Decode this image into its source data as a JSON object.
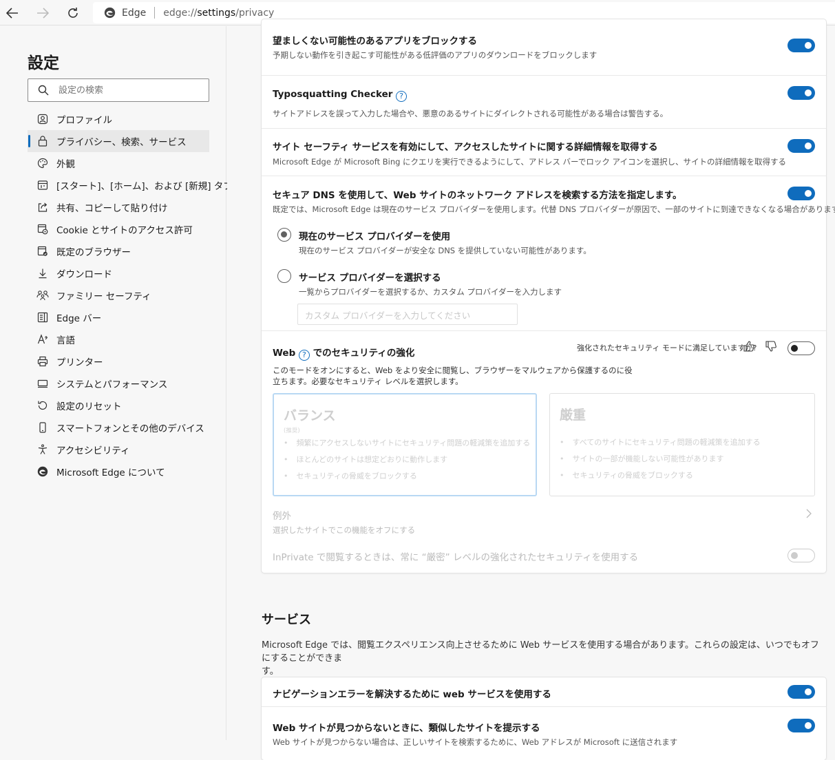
{
  "browser": {
    "site_label": "Edge",
    "url_scheme": "edge://",
    "url_host": "settings",
    "url_path": "/privacy"
  },
  "sidebar": {
    "title": "設定",
    "search_placeholder": "設定の検索",
    "items": [
      {
        "label": "プロファイル",
        "icon": "profile-icon"
      },
      {
        "label": "プライバシー、検索、サービス",
        "icon": "lock-icon",
        "active": true
      },
      {
        "label": "外観",
        "icon": "palette-icon"
      },
      {
        "label": "[スタート]、[ホーム]、および [新規] タブ",
        "icon": "home-tab-icon"
      },
      {
        "label": "共有、コピーして貼り付け",
        "icon": "share-icon"
      },
      {
        "label": "Cookie とサイトのアクセス許可",
        "icon": "cookie-icon"
      },
      {
        "label": "既定のブラウザー",
        "icon": "browser-icon"
      },
      {
        "label": "ダウンロード",
        "icon": "download-icon"
      },
      {
        "label": "ファミリー セーフティ",
        "icon": "family-icon"
      },
      {
        "label": "Edge バー",
        "icon": "edge-bar-icon"
      },
      {
        "label": "言語",
        "icon": "language-icon"
      },
      {
        "label": "プリンター",
        "icon": "printer-icon"
      },
      {
        "label": "システムとパフォーマンス",
        "icon": "system-icon"
      },
      {
        "label": "設定のリセット",
        "icon": "reset-icon"
      },
      {
        "label": "スマートフォンとその他のデバイス",
        "icon": "phone-icon"
      },
      {
        "label": "アクセシビリティ",
        "icon": "accessibility-icon"
      },
      {
        "label": "Microsoft Edge について",
        "icon": "edge-logo-icon"
      }
    ]
  },
  "security": {
    "pua": {
      "title": "望ましくない可能性のあるアプリをブロックする",
      "desc": "予期しない動作を引き起こす可能性がある低評価のアプリのダウンロードをブロックします",
      "on": true
    },
    "typo": {
      "title": "Typosquatting Checker",
      "desc": "サイトアドレスを誤って入力した場合や、悪意のあるサイトにダイレクトされる可能性がある場合は警告する。",
      "on": true
    },
    "site_safety": {
      "title": "サイト セーフティ サービスを有効にして、アクセスしたサイトに関する詳細情報を取得する",
      "desc": "Microsoft Edge が Microsoft Bing にクエリを実行できるようにして、アドレス バーでロック アイコンを選択し、サイトの詳細情報を取得する",
      "on": true
    },
    "dns": {
      "title": "セキュア DNS を使用して、Web サイトのネットワーク アドレスを検索する方法を指定します。",
      "desc": "既定では、Microsoft Edge は現在のサービス プロバイダーを使用します。代替 DNS プロバイダーが原因で、一部のサイトに到達できなくなる場合があります。",
      "on": true,
      "opt1_title": "現在のサービス プロバイダーを使用",
      "opt1_desc": "現在のサービス プロバイダーが安全な DNS を提供していない可能性があります。",
      "opt2_title": "サービス プロバイダーを選択する",
      "opt2_desc": "一覧からプロバイダーを選択するか、カスタム プロバイダーを入力します",
      "custom_placeholder": "カスタム プロバイダーを入力してください"
    },
    "enhanced": {
      "title_a": "Web",
      "title_b": "でのセキュリティの強化",
      "feedback": "強化されたセキュリティ モードに満足していますか?",
      "desc_1": "このモードをオンにすると、Web をより安全に閲覧し、ブラウザーをマルウェアから保護するのに役",
      "desc_2": "立ちます。必要なセキュリティ レベルを選択します。",
      "on": false,
      "balanced": {
        "title": "バランス",
        "sub": "(推奨)",
        "bullets": [
          "頻繁にアクセスしないサイトにセキュリティ問題の軽減策を追加する",
          "ほとんどのサイトは想定どおりに動作します",
          "セキュリティの脅威をブロックする"
        ]
      },
      "strict": {
        "title": "厳重",
        "bullets": [
          "すべてのサイトにセキュリティ問題の軽減策を追加する",
          "サイトの一部が機能しない可能性があります",
          "セキュリティの脅威をブロックする"
        ]
      },
      "exceptions_title": "例外",
      "exceptions_desc": "選択したサイトでこの機能をオフにする",
      "inprivate": "InPrivate で閲覧するときは、常に “厳密” レベルの強化されたセキュリティを使用する"
    }
  },
  "services": {
    "title": "サービス",
    "desc_1": "Microsoft Edge では、閲覧エクスペリエンス向上させるために Web サービスを使用する場合があります。これらの設定は、いつでもオフにすることができま",
    "desc_2": "す。",
    "nav_error": "ナビゲーションエラーを解決するために web サービスを使用する",
    "similar_site": "Web サイトが見つからないときに、類似したサイトを提示する",
    "similar_site_desc": "Web サイトが見つからない場合は、正しいサイトを検索するために、Web アドレスが Microsoft に送信されます"
  }
}
